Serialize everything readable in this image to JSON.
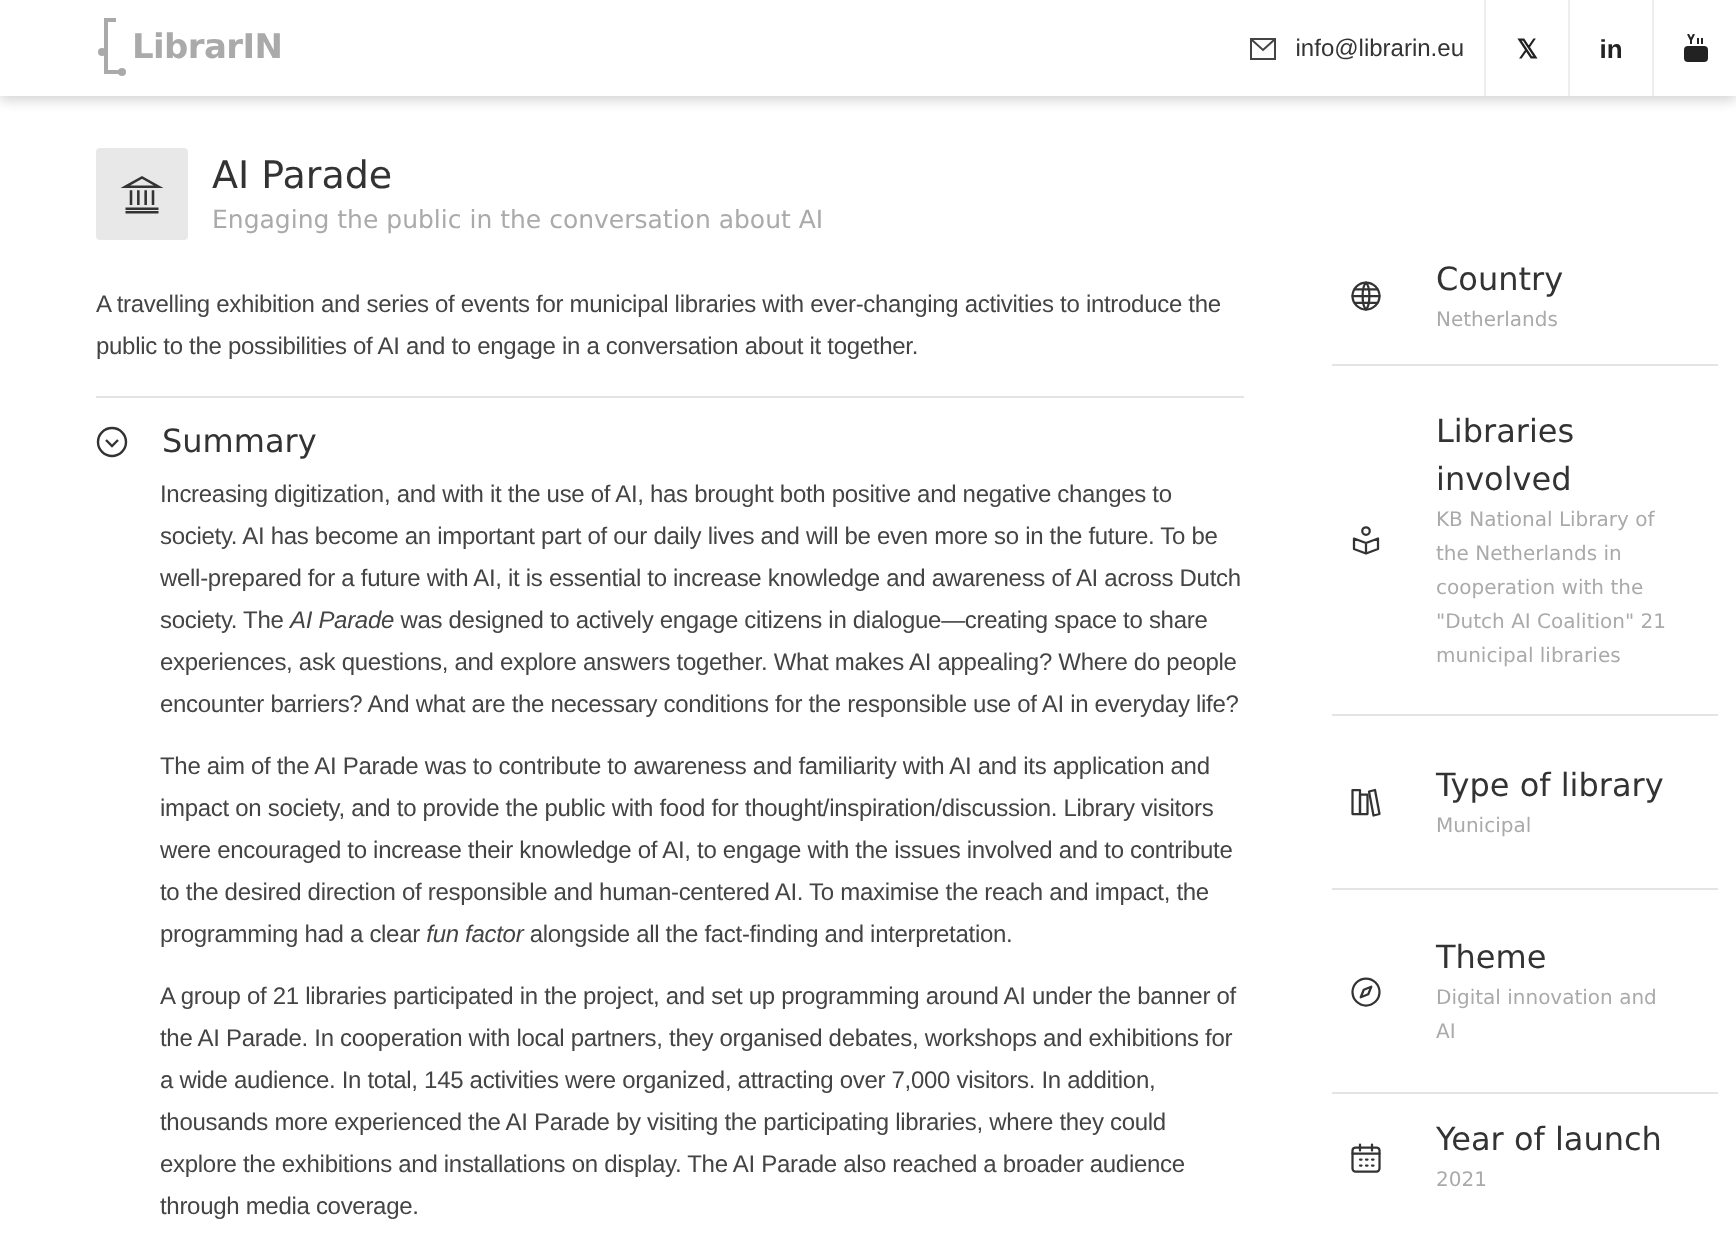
{
  "header": {
    "logo": "LibrarIN",
    "email": "info@librarin.eu",
    "social": [
      "𝕏",
      "in"
    ]
  },
  "project": {
    "title": "AI Parade",
    "subtitle": "Engaging the public in the conversation about AI",
    "intro": "A travelling exhibition and series of events for municipal libraries with ever-changing activities to introduce the public to the possibilities of AI and to engage in a conversation about it together."
  },
  "summary": {
    "title": "Summary",
    "expanded": true,
    "paragraphs": [
      "Increasing digitization, and with it the use of AI, has brought both positive and negative changes to society. AI has become an important part of our daily lives and will be even more so in the future. To be well-prepared for a future with AI, it is essential to increase knowledge and awareness of AI across Dutch society. The *AI Parade* was designed to actively engage citizens in dialogue—creating space to share experiences, ask questions, and explore answers together. What makes AI appealing? Where do people encounter barriers? And what are the necessary conditions for the responsible use of AI in everyday life?",
      "The aim of the AI Parade was to contribute to awareness and familiarity with AI and its application and impact on society, and to provide the public with food for thought/inspiration/discussion. Library visitors were encouraged to increase their knowledge of AI, to engage with the issues involved and to contribute to the desired direction of responsible and human-centered AI. To maximise the reach and impact, the programming had a clear *fun factor* alongside all the fact-finding and interpretation.",
      "A group of 21 libraries participated in the project, and set up programming around AI under the banner of the AI Parade. In cooperation with local partners, they organised debates, workshops and exhibitions for a wide audience.  In total, 145 activities were organized, attracting over 7,000 visitors. In addition, thousands more experienced the AI Parade by visiting the participating libraries, where they could explore the exhibitions and installations on display. The AI Parade also reached a broader audience through media coverage."
    ]
  },
  "facts": [
    {
      "label": "Country",
      "value": "Netherlands"
    },
    {
      "label": "Libraries involved",
      "value": "KB National Library of the Netherlands in cooperation with the \"Dutch AI Coalition\" 21 municipal libraries"
    },
    {
      "label": "Type of library",
      "value": "Municipal"
    },
    {
      "label": "Theme",
      "value": "Digital innovation and AI"
    },
    {
      "label": "Year of launch",
      "value": "2021"
    }
  ]
}
